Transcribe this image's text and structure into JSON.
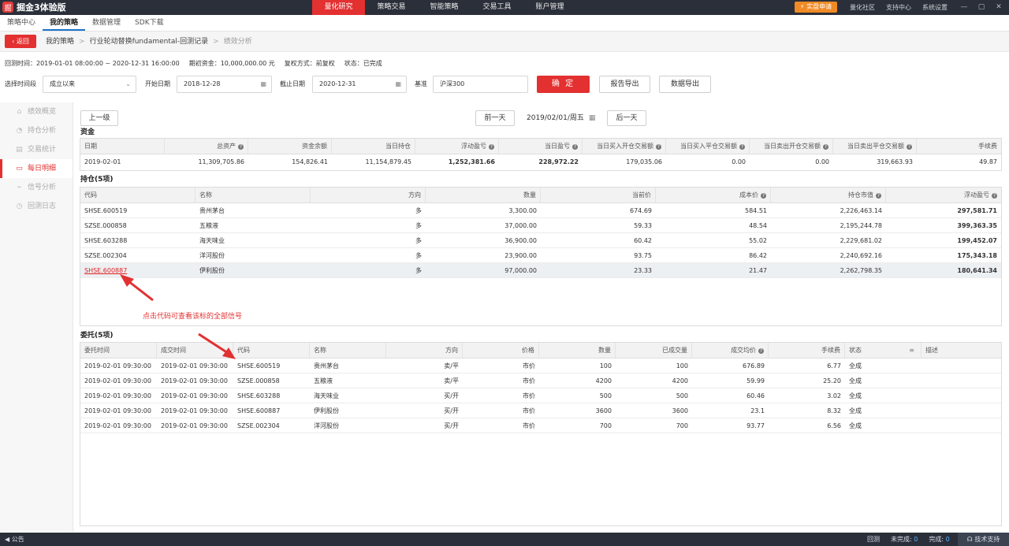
{
  "app": {
    "logo_glyph": "掘",
    "title": "掘金3体验版"
  },
  "main_nav": [
    "量化研究",
    "策略交易",
    "智能策略",
    "交易工具",
    "账户管理"
  ],
  "upgrade_label": "⚡ 实盘申请",
  "top_links": [
    "量化社区",
    "支持中心",
    "系统设置"
  ],
  "window_controls": [
    "—",
    "▢",
    "✕"
  ],
  "sub_nav": [
    "策略中心",
    "我的策略",
    "数据管理",
    "SDK下载"
  ],
  "back_label": "返回",
  "breadcrumb": [
    "我的策略",
    "行业轮动替换fundamental-回测记录",
    "绩效分析"
  ],
  "info": {
    "period": "回测时间：2019-01-01 08:00:00 ~ 2020-12-31 16:00:00",
    "capital": "期初资金：10,000,000.00 元",
    "adjust": "复权方式：前复权",
    "status": "状态：已完成"
  },
  "filters": {
    "range_label": "选择时间段",
    "range_value": "成立以来",
    "start_label": "开始日期",
    "start_value": "2018-12-28",
    "end_label": "截止日期",
    "end_value": "2020-12-31",
    "bench_label": "基准",
    "bench_value": "沪深300",
    "ok_label": "确 定",
    "report_export": "报告导出",
    "data_export": "数据导出"
  },
  "sidebar": [
    {
      "icon": "⌂",
      "label": "绩效概览"
    },
    {
      "icon": "◔",
      "label": "持仓分析"
    },
    {
      "icon": "▤",
      "label": "交易统计"
    },
    {
      "icon": "▭",
      "label": "每日明细"
    },
    {
      "icon": "⌁",
      "label": "信号分析"
    },
    {
      "icon": "◷",
      "label": "回测日志"
    }
  ],
  "day_nav": {
    "up_level": "上一级",
    "prev": "前一天",
    "date": "2019/02/01/周五",
    "next": "后一天"
  },
  "capital": {
    "title": "资金",
    "headers": [
      "日期",
      "总资产",
      "资金余额",
      "当日持仓",
      "浮动盈亏",
      "当日盈亏",
      "当日买入开仓交易额",
      "当日买入平仓交易额",
      "当日卖出开仓交易额",
      "当日卖出平仓交易额",
      "手续费"
    ],
    "rows": [
      [
        "2019-02-01",
        "11,309,705.86",
        "154,826.41",
        "11,154,879.45",
        "1,252,381.66",
        "228,972.22",
        "179,035.06",
        "0.00",
        "0.00",
        "319,663.93",
        "49.87"
      ]
    ]
  },
  "positions": {
    "title": "持仓(5项)",
    "headers": [
      "代码",
      "名称",
      "方向",
      "数量",
      "当前价",
      "成本价",
      "持仓市值",
      "浮动盈亏"
    ],
    "rows": [
      [
        "SHSE.600519",
        "贵州茅台",
        "多",
        "3,300.00",
        "674.69",
        "584.51",
        "2,226,463.14",
        "297,581.71"
      ],
      [
        "SZSE.000858",
        "五粮液",
        "多",
        "37,000.00",
        "59.33",
        "48.54",
        "2,195,244.78",
        "399,363.35"
      ],
      [
        "SHSE.603288",
        "海天味业",
        "多",
        "36,900.00",
        "60.42",
        "55.02",
        "2,229,681.02",
        "199,452.07"
      ],
      [
        "SZSE.002304",
        "洋河股份",
        "多",
        "23,900.00",
        "93.75",
        "86.42",
        "2,240,692.16",
        "175,343.18"
      ],
      [
        "SHSE.600887",
        "伊利股份",
        "多",
        "97,000.00",
        "23.33",
        "21.47",
        "2,262,798.35",
        "180,641.34"
      ]
    ]
  },
  "annotation": "点击代码可查看该标的全部信号",
  "orders": {
    "title": "委托(5项)",
    "headers": [
      "委托时间",
      "成交时间",
      "代码",
      "名称",
      "方向",
      "价格",
      "数量",
      "已成交量",
      "成交均价",
      "手续费",
      "状态",
      "描述"
    ],
    "rows": [
      [
        "2019-02-01 09:30:00",
        "2019-02-01 09:30:00",
        "SHSE.600519",
        "贵州茅台",
        "卖/平",
        "市价",
        "100",
        "100",
        "676.89",
        "6.77",
        "全成",
        ""
      ],
      [
        "2019-02-01 09:30:00",
        "2019-02-01 09:30:00",
        "SZSE.000858",
        "五粮液",
        "卖/平",
        "市价",
        "4200",
        "4200",
        "59.99",
        "25.20",
        "全成",
        ""
      ],
      [
        "2019-02-01 09:30:00",
        "2019-02-01 09:30:00",
        "SHSE.603288",
        "海天味业",
        "买/开",
        "市价",
        "500",
        "500",
        "60.46",
        "3.02",
        "全成",
        ""
      ],
      [
        "2019-02-01 09:30:00",
        "2019-02-01 09:30:00",
        "SHSE.600887",
        "伊利股份",
        "买/开",
        "市价",
        "3600",
        "3600",
        "23.1",
        "8.32",
        "全成",
        ""
      ],
      [
        "2019-02-01 09:30:00",
        "2019-02-01 09:30:00",
        "SZSE.002304",
        "洋河股份",
        "买/开",
        "市价",
        "700",
        "700",
        "93.77",
        "6.56",
        "全成",
        ""
      ]
    ]
  },
  "status_bar": {
    "notice": "公告",
    "backtest": "回测",
    "unfinished": "未完成:",
    "unfinished_count": "0",
    "finished": "完成:",
    "finished_count": "0",
    "tech_support": "技术支持"
  },
  "colors": {
    "accent": "#e33030",
    "topbar": "#2a2f39",
    "profit": "#e02020"
  }
}
